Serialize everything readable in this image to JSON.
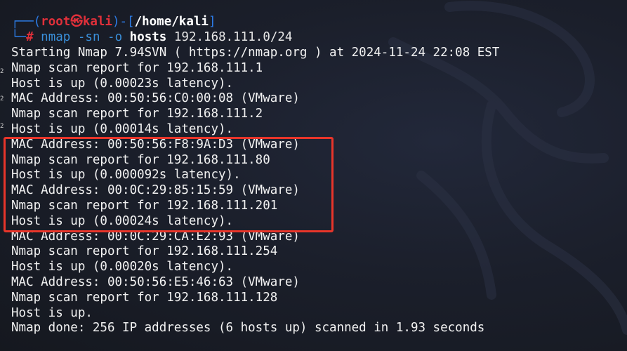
{
  "prompt": {
    "user": "root",
    "skull": "㉿",
    "host": "kali",
    "path": "/home/kali",
    "hash": "#",
    "command": "nmap",
    "flag_sn": "-sn",
    "flag_o": "-o",
    "arg_file": "hosts",
    "target": "192.168.111.0/24"
  },
  "output_lines": [
    "Starting Nmap 7.94SVN ( https://nmap.org ) at 2024-11-24 22:08 EST",
    "Nmap scan report for 192.168.111.1",
    "Host is up (0.00023s latency).",
    "MAC Address: 00:50:56:C0:00:08 (VMware)",
    "Nmap scan report for 192.168.111.2",
    "Host is up (0.00014s latency).",
    "MAC Address: 00:50:56:F8:9A:D3 (VMware)",
    "Nmap scan report for 192.168.111.80",
    "Host is up (0.000092s latency).",
    "MAC Address: 00:0C:29:85:15:59 (VMware)",
    "Nmap scan report for 192.168.111.201",
    "Host is up (0.00024s latency).",
    "MAC Address: 00:0C:29:CA:E2:93 (VMware)",
    "Nmap scan report for 192.168.111.254",
    "Host is up (0.00020s latency).",
    "MAC Address: 00:50:56:E5:46:63 (VMware)",
    "Nmap scan report for 192.168.111.128",
    "Host is up.",
    "Nmap done: 256 IP addresses (6 hosts up) scanned in 1.93 seconds"
  ],
  "edge_marks": [
    "2",
    "2",
    "2"
  ],
  "colors": {
    "background": "#1a1d27",
    "prompt_frame": "#2c7be5",
    "prompt_user": "#e0303a",
    "text": "#f2f2f2",
    "highlight": "#e8352a"
  }
}
